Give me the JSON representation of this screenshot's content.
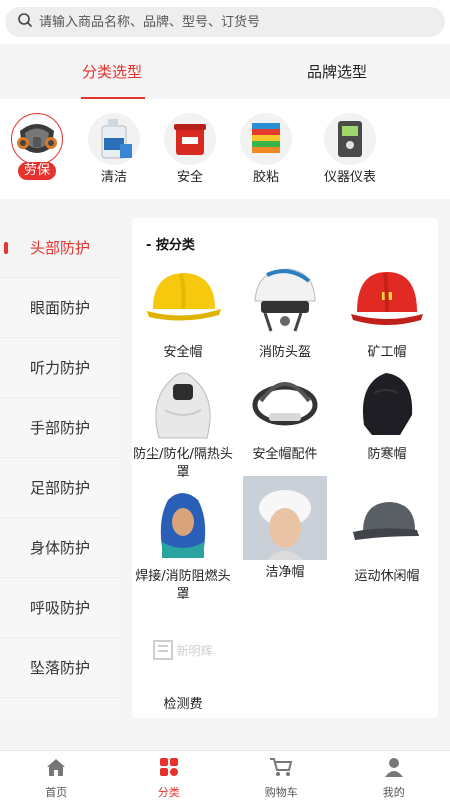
{
  "search": {
    "placeholder": "请输入商品名称、品牌、型号、订货号"
  },
  "tabs": [
    {
      "label": "分类选型",
      "active": true
    },
    {
      "label": "品牌选型",
      "active": false
    }
  ],
  "categories": [
    {
      "label": "劳保",
      "icon": "respirator-icon",
      "active": true
    },
    {
      "label": "清洁",
      "icon": "cleaner-bottle-icon",
      "active": false
    },
    {
      "label": "安全",
      "icon": "safety-bin-icon",
      "active": false
    },
    {
      "label": "胶粘",
      "icon": "tape-roll-icon",
      "active": false
    },
    {
      "label": "仪器仪表",
      "icon": "gas-detector-icon",
      "active": false
    }
  ],
  "sidebar": {
    "items": [
      {
        "label": "头部防护",
        "active": true
      },
      {
        "label": "眼面防护"
      },
      {
        "label": "听力防护"
      },
      {
        "label": "手部防护"
      },
      {
        "label": "足部防护"
      },
      {
        "label": "身体防护"
      },
      {
        "label": "呼吸防护"
      },
      {
        "label": "坠落防护"
      }
    ]
  },
  "content": {
    "section_title": "按分类",
    "products": [
      {
        "name": "安全帽",
        "icon": "yellow-helmet-icon"
      },
      {
        "name": "消防头盔",
        "icon": "fire-helmet-icon"
      },
      {
        "name": "矿工帽",
        "icon": "red-miner-helmet-icon"
      },
      {
        "name": "防尘/防化/隔热头罩",
        "icon": "protective-hood-icon"
      },
      {
        "name": "安全帽配件",
        "icon": "helmet-harness-icon"
      },
      {
        "name": "防寒帽",
        "icon": "winter-hat-icon"
      },
      {
        "name": "焊接/消防阻燃头罩",
        "icon": "welding-hood-icon"
      },
      {
        "name": "洁净帽",
        "icon": "clean-cap-icon"
      },
      {
        "name": "运动休闲帽",
        "icon": "baseball-cap-icon"
      },
      {
        "name": "检测费",
        "icon": "placeholder-logo-icon"
      }
    ],
    "placeholder_logo_text": "新明辉"
  },
  "bottom_nav": [
    {
      "label": "首页",
      "icon": "home-icon"
    },
    {
      "label": "分类",
      "icon": "category-icon",
      "active": true
    },
    {
      "label": "购物车",
      "icon": "cart-icon"
    },
    {
      "label": "我的",
      "icon": "user-icon"
    }
  ],
  "colors": {
    "accent": "#e5322d"
  }
}
